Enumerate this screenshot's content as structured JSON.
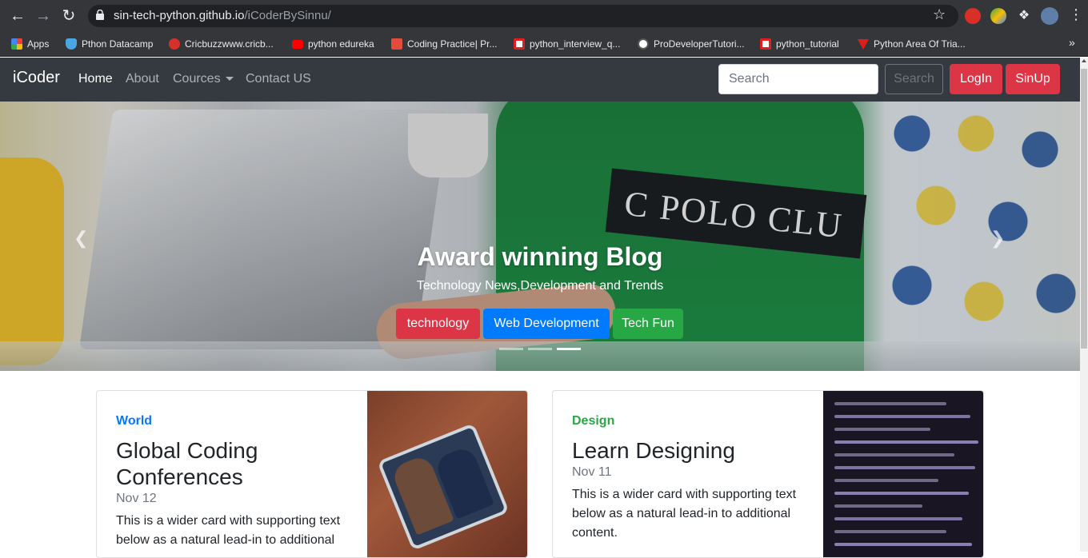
{
  "browser": {
    "url_host": "sin-tech-python.github.io",
    "url_path": "/iCoderBySinnu/",
    "bookmarks": [
      {
        "label": "Apps",
        "icon": "apps-grid-icon",
        "color": "#e94235"
      },
      {
        "label": "Pthon Datacamp",
        "icon": "shield-icon",
        "color": "#4aa6e0"
      },
      {
        "label": "Cricbuzzwww.cricb...",
        "icon": "cricket-ball-icon",
        "color": "#d6302a"
      },
      {
        "label": "python edureka",
        "icon": "youtube-icon",
        "color": "#ff0000"
      },
      {
        "label": "Coding Practice| Pr...",
        "icon": "tg-logo-icon",
        "color": "#e34b3d"
      },
      {
        "label": "python_interview_q...",
        "icon": "n-logo-icon",
        "color": "#e02020"
      },
      {
        "label": "ProDeveloperTutori...",
        "icon": "globe-icon",
        "color": "#ffffff"
      },
      {
        "label": "python_tutorial",
        "icon": "n-logo-icon",
        "color": "#e02020"
      },
      {
        "label": "Python Area Of Tria...",
        "icon": "triangle-logo-icon",
        "color": "#e21b1b"
      }
    ]
  },
  "navbar": {
    "brand": "iCoder",
    "links": [
      "Home",
      "About",
      "Cources",
      "Contact US"
    ],
    "search_placeholder": "Search",
    "search_button": "Search",
    "login": "LogIn",
    "signup": "SinUp"
  },
  "carousel": {
    "title": "Award winning Blog",
    "subtitle": "Technology News,Development and Trends",
    "buttons": [
      {
        "label": "technology",
        "color": "#dc3545"
      },
      {
        "label": "Web Development",
        "color": "#007bff"
      },
      {
        "label": "Tech Fun",
        "color": "#28a745"
      }
    ],
    "active_slide": 3,
    "slide_count": 3
  },
  "cards": [
    {
      "category": "World",
      "category_color": "#007bff",
      "title": "Global Coding Conferences",
      "date": "Nov 12",
      "text": "This is a wider card with supporting text below as a natural lead-in to additional"
    },
    {
      "category": "Design",
      "category_color": "#28a745",
      "title": "Learn Designing",
      "date": "Nov 11",
      "text": "This is a wider card with supporting text below as a natural lead-in to additional content."
    }
  ]
}
